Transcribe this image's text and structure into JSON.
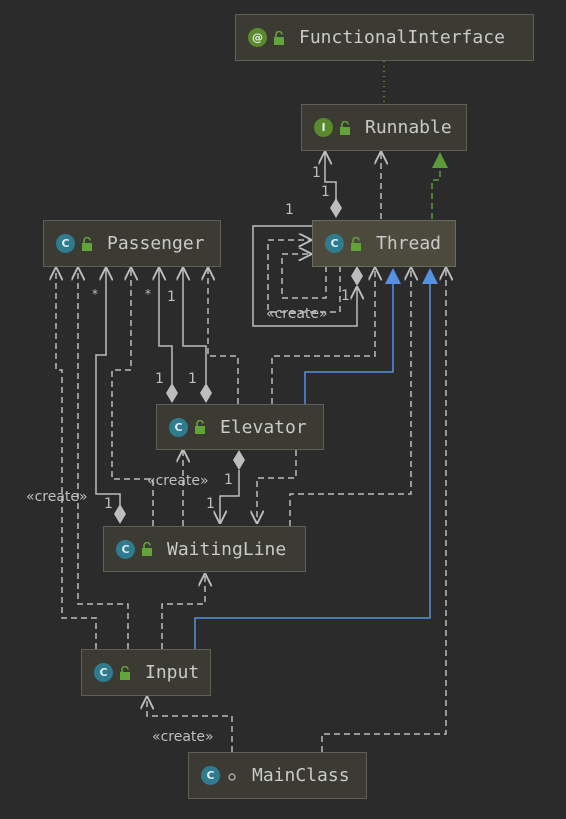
{
  "nodes": {
    "functional_interface": {
      "name": "FunctionalInterface",
      "kind": "annotation",
      "badge": "@"
    },
    "runnable": {
      "name": "Runnable",
      "kind": "interface",
      "badge": "I"
    },
    "passenger": {
      "name": "Passenger",
      "kind": "class",
      "badge": "C"
    },
    "thread": {
      "name": "Thread",
      "kind": "class",
      "badge": "C"
    },
    "elevator": {
      "name": "Elevator",
      "kind": "class",
      "badge": "C"
    },
    "waiting_line": {
      "name": "WaitingLine",
      "kind": "class",
      "badge": "C"
    },
    "input": {
      "name": "Input",
      "kind": "class",
      "badge": "C"
    },
    "main_class": {
      "name": "MainClass",
      "kind": "main-class",
      "badge": "C"
    }
  },
  "labels": {
    "create": "«create»",
    "one": "1",
    "many": "*"
  },
  "colors": {
    "background": "#2b2b2b",
    "edge": "#bdbdbd",
    "implements": "#5b9b3a",
    "extends": "#5591e0",
    "annotation_link": "#8a8a3c"
  }
}
